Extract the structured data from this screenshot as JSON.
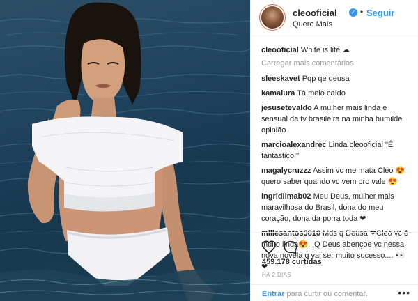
{
  "post": {
    "username": "cleooficial",
    "verified_badge": "✓",
    "separator": "•",
    "follow_label": "Seguir",
    "location": "Quero Mais"
  },
  "caption": {
    "username": "cleooficial",
    "text": "White is life ☁"
  },
  "load_more_label": "Carregar mais comentários",
  "comments": [
    {
      "username": "sleeskavet",
      "text": "Pqp qe deusa"
    },
    {
      "username": "kamaiura",
      "text": "Tá meio caído"
    },
    {
      "username": "jesusetevaldo",
      "text": "A mulher mais linda e sensual da tv brasileira na minha humilde opinião"
    },
    {
      "username": "marcioalexandrec",
      "text": "Linda cleooficial \"É fantástico!\""
    },
    {
      "username": "magalycruzzz",
      "text": "Assim vc me mata Cléo 😍 quero saber quando vc vem pro vale 😍"
    },
    {
      "username": "ingridlimab02",
      "text": "Meu Deus, mulher mais maravilhosa do Brasil, dona do meu coração, dona da porra toda ❤"
    },
    {
      "username": "millesantos9810",
      "text": "Mds q Deusa ❤Cleo vc é muito linda😍...Q Deus abençoe vc nessa nova novela q vai ser muito sucesso.... 👀❤"
    }
  ],
  "icons": {
    "like": "heart-icon",
    "comment": "comment-bubble-icon",
    "more": "more-options-icon"
  },
  "likes_text": "459.178 curtidas",
  "time_text": "HÁ 2 DIAS",
  "comment_bar": {
    "enter_label": "Entrar",
    "rest_text": " para curtir ou comentar.",
    "more_label": "•••"
  },
  "colors": {
    "link_blue": "#3897f0",
    "muted": "#999999",
    "text": "#262626",
    "border": "#efefef"
  }
}
